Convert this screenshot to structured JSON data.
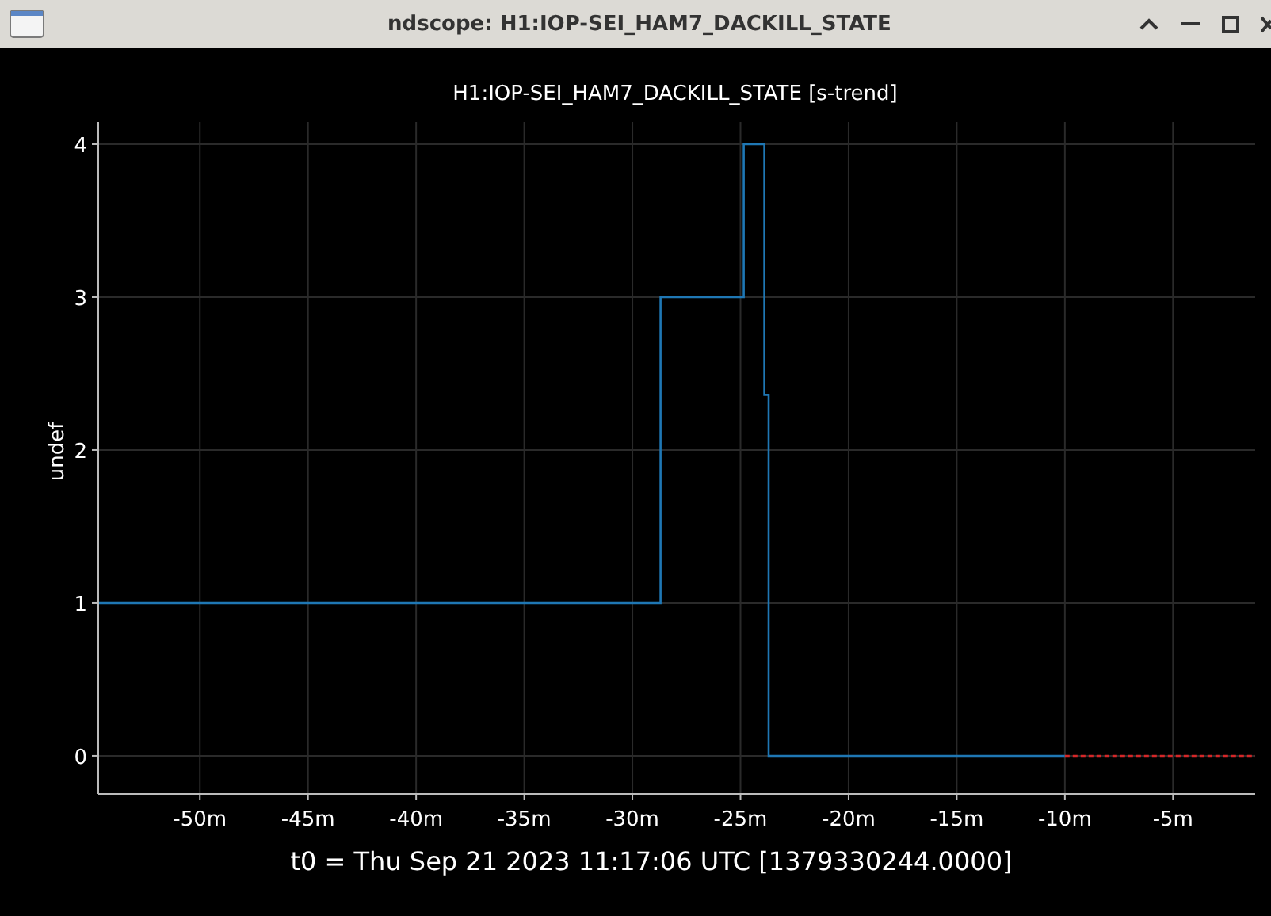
{
  "window": {
    "title": "ndscope: H1:IOP-SEI_HAM7_DACKILL_STATE"
  },
  "plot": {
    "chart_data": {
      "type": "line",
      "title": "H1:IOP-SEI_HAM7_DACKILL_STATE [s-trend]",
      "ylabel": "undef",
      "xlim": [
        -54.7,
        -1.2
      ],
      "ylim": [
        -0.249,
        4.145
      ],
      "grid": true,
      "yticks": [
        0,
        1,
        2,
        3,
        4
      ],
      "xticks": [
        {
          "value": -50,
          "label": "-50m"
        },
        {
          "value": -45,
          "label": "-45m"
        },
        {
          "value": -40,
          "label": "-40m"
        },
        {
          "value": -35,
          "label": "-35m"
        },
        {
          "value": -30,
          "label": "-30m"
        },
        {
          "value": -25,
          "label": "-25m"
        },
        {
          "value": -20,
          "label": "-20m"
        },
        {
          "value": -15,
          "label": "-15m"
        },
        {
          "value": -10,
          "label": "-10m"
        },
        {
          "value": -5,
          "label": "-5m"
        }
      ],
      "series": [
        {
          "color": "#1f77b4",
          "line_style": "solid",
          "x": [
            -54.7,
            -28.7,
            -28.7,
            -24.85,
            -24.85,
            -23.9,
            -23.9,
            -23.7,
            -23.7,
            -10
          ],
          "values": [
            1,
            1,
            3,
            3,
            4,
            4,
            2.36,
            2.36,
            0,
            0
          ]
        },
        {
          "color": "#d62728",
          "line_style": "dashed",
          "x": [
            -10,
            -1.2
          ],
          "values": [
            0,
            0
          ]
        }
      ]
    },
    "t0": "t0 = Thu Sep 21 2023 11:17:06 UTC [1379330244.0000]"
  }
}
